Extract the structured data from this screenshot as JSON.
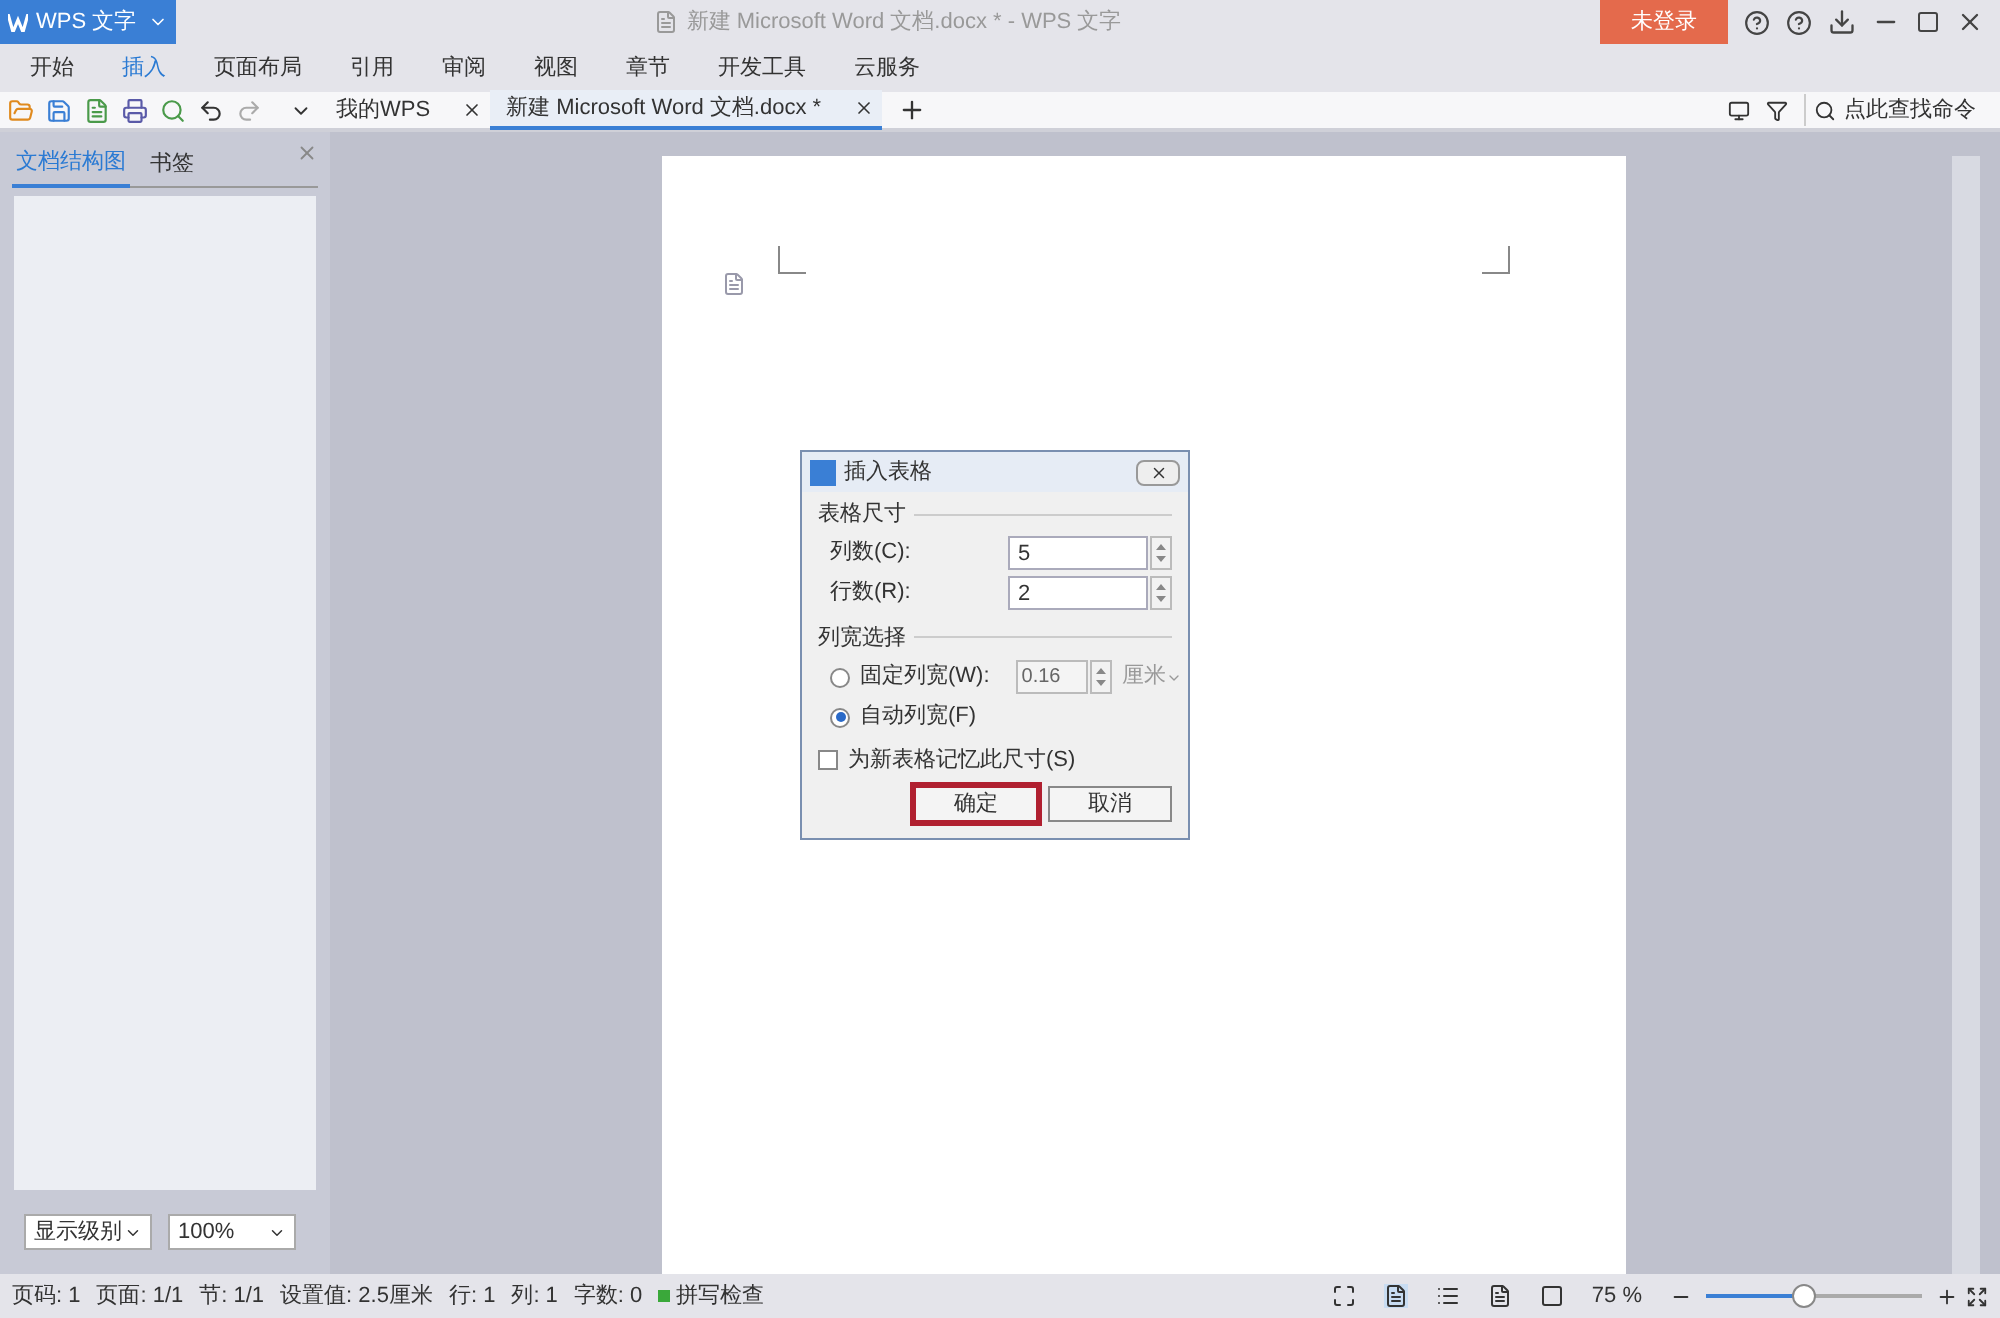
{
  "app_menu": "WPS 文字",
  "window": {
    "title": "新建 Microsoft Word 文档.docx * - WPS 文字",
    "login_button": "未登录"
  },
  "ribbon_tabs": [
    {
      "label": "开始",
      "selected": false
    },
    {
      "label": "插入",
      "selected": true
    },
    {
      "label": "页面布局",
      "selected": false
    },
    {
      "label": "引用",
      "selected": false
    },
    {
      "label": "审阅",
      "selected": false
    },
    {
      "label": "视图",
      "selected": false
    },
    {
      "label": "章节",
      "selected": false
    },
    {
      "label": "开发工具",
      "selected": false
    },
    {
      "label": "云服务",
      "selected": false
    }
  ],
  "doc_tabs": [
    {
      "label": "我的WPS",
      "selected": false
    },
    {
      "label": "新建 Microsoft Word 文档.docx *",
      "selected": true
    }
  ],
  "search": {
    "placeholder": "点此查找命令"
  },
  "side_panel": {
    "tabs": [
      {
        "label": "文档结构图",
        "selected": true
      },
      {
        "label": "书签",
        "selected": false
      }
    ],
    "level_dropdown": "显示级别",
    "zoom_dropdown": "100%"
  },
  "dialog": {
    "title": "插入表格",
    "size_section": "表格尺寸",
    "fields": [
      {
        "label": "列数(C):",
        "value": "5"
      },
      {
        "label": "行数(R):",
        "value": "2"
      }
    ],
    "width_section": "列宽选择",
    "options": [
      {
        "label": "固定列宽(W):",
        "selected": false
      },
      {
        "label": "自动列宽(F)",
        "selected": true
      }
    ],
    "fixed_width": {
      "value": "0.16",
      "unit": "厘米",
      "disabled": true
    },
    "remember": {
      "label": "为新表格记忆此尺寸(S)",
      "checked": false
    },
    "buttons": [
      {
        "label": "确定",
        "focused": true
      },
      {
        "label": "取消",
        "focused": false
      }
    ]
  },
  "status_bar": {
    "items": [
      "页码: 1",
      "页面: 1/1",
      "节: 1/1",
      "设置值: 2.5厘米",
      "行: 1",
      "列: 1",
      "字数: 0"
    ],
    "spell_check": "拼写检查",
    "zoom": "75 %",
    "zoom_slider": {
      "level": 0.45
    }
  }
}
